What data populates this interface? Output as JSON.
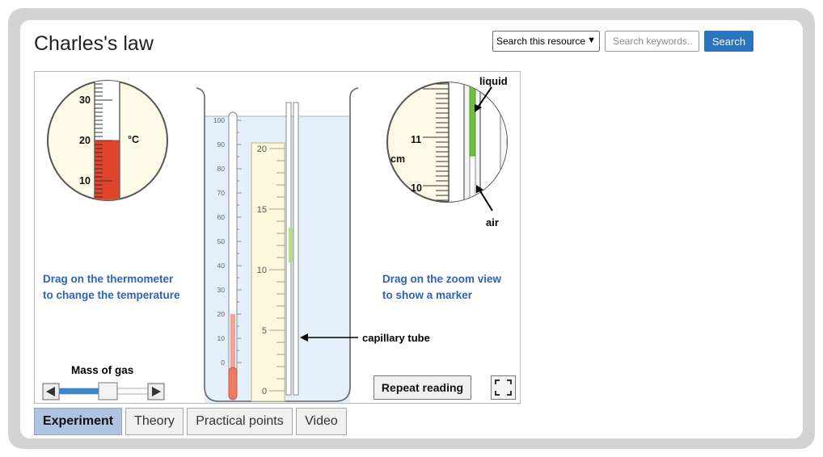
{
  "header": {
    "title": "Charles's law",
    "scope_select": "Search this resource",
    "search_placeholder": "Search keywords..",
    "search_button": "Search"
  },
  "simulation": {
    "thermo_zoom": {
      "ticks": [
        "30",
        "20",
        "10"
      ],
      "unit": "°C",
      "temperature_c": 20
    },
    "tube_zoom": {
      "ticks": [
        "11",
        "10"
      ],
      "unit": "cm",
      "liquid_label": "liquid",
      "air_label": "air"
    },
    "thermometer_ticks": [
      "100",
      "90",
      "80",
      "70",
      "60",
      "50",
      "40",
      "30",
      "20",
      "10",
      "0"
    ],
    "ruler_ticks": [
      "20",
      "15",
      "10",
      "5",
      "0"
    ],
    "left_hint": [
      "Drag on the thermometer",
      "to change the temperature"
    ],
    "right_hint": [
      "Drag on the zoom view",
      "to show a marker"
    ],
    "capillary_label": "capillary tube",
    "mass_label": "Mass of gas",
    "mass_level": 0.45,
    "repeat_button": "Repeat reading"
  },
  "tabs": [
    "Experiment",
    "Theory",
    "Practical points",
    "Video"
  ],
  "active_tab": "Experiment",
  "colors": {
    "accent": "#2b74c0",
    "hint_text": "#2e63b8",
    "mercury": "#e0452b",
    "liquid": "#6cc13b",
    "water": "#e3f0fb"
  },
  "icons": {
    "fullscreen": "fullscreen-icon",
    "left_arrow": "arrow-left-icon",
    "right_arrow": "arrow-right-icon"
  }
}
